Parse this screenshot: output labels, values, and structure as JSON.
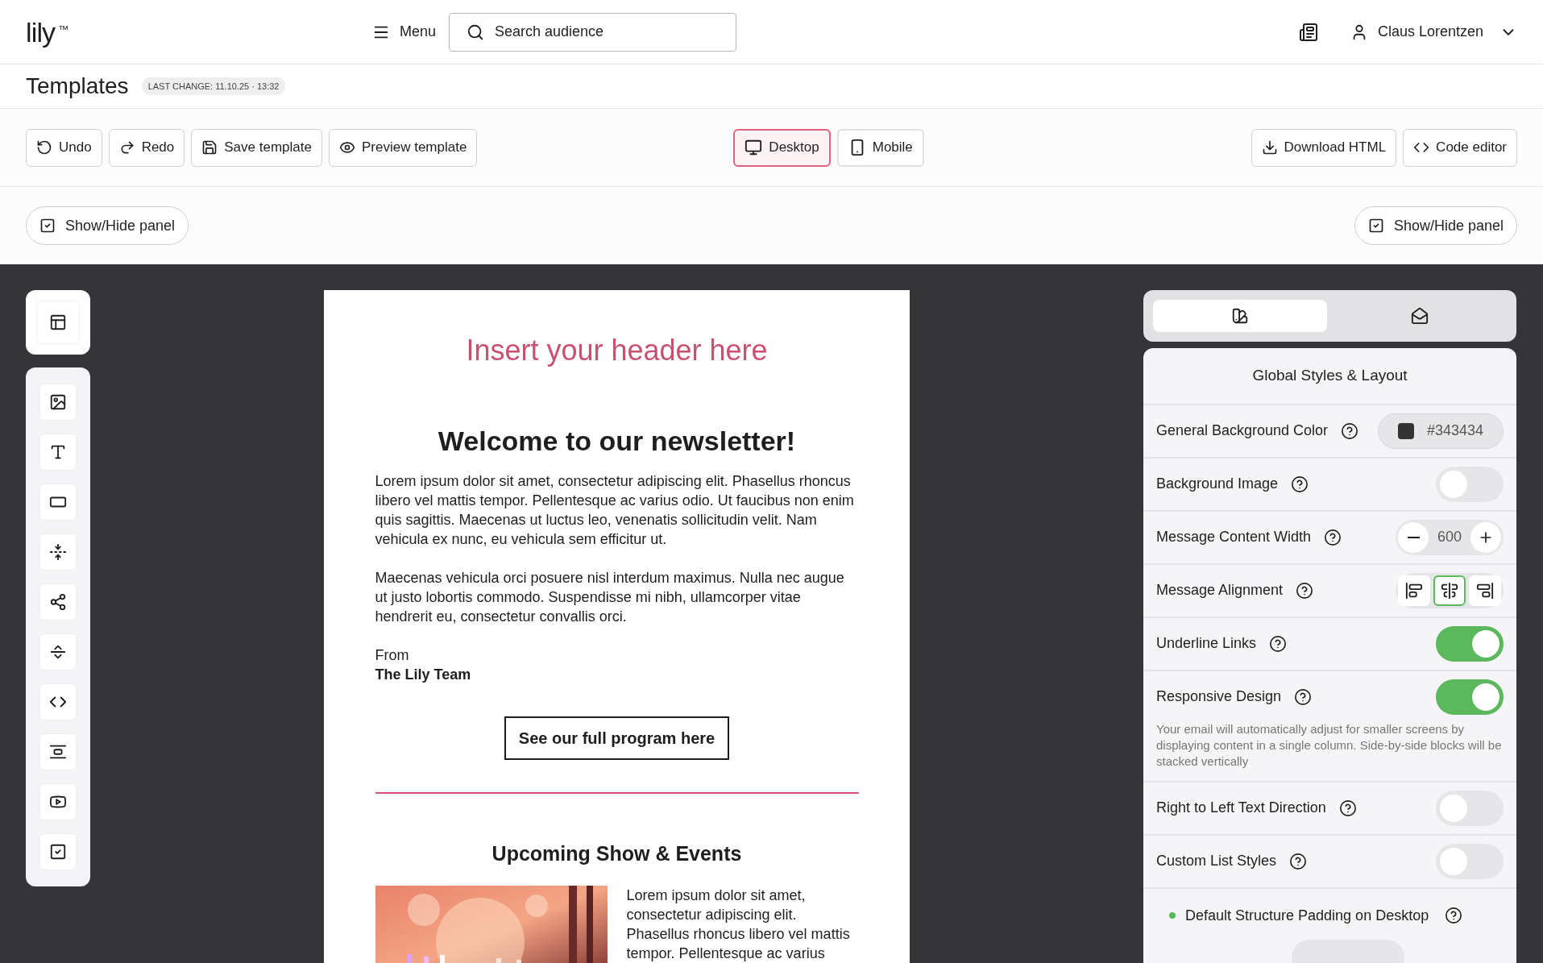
{
  "header": {
    "logo": "lily",
    "logo_mark": "™",
    "menu": "Menu",
    "search_placeholder": "Search audience",
    "user": "Claus Lorentzen"
  },
  "page": {
    "title": "Templates",
    "last_change": "LAST CHANGE: 11.10.25 · 13:32"
  },
  "toolbar": {
    "left": [
      "Undo",
      "Redo",
      "Save template",
      "Preview template"
    ],
    "views": [
      {
        "label": "Desktop",
        "selected": true
      },
      {
        "label": "Mobile",
        "selected": false
      }
    ],
    "right": [
      "Download HTML",
      "Code editor"
    ]
  },
  "panel_toggles": [
    "Show/Hide panel",
    "Show/Hide panel"
  ],
  "email": {
    "header": "Insert your header here",
    "title": "Welcome to our newsletter!",
    "paragraphs": [
      "Lorem ipsum dolor sit amet, consectetur adipiscing elit. Phasellus rhoncus libero vel mattis tempor. Pellentesque ac varius odio. Ut faucibus non enim quis sagittis. Maecenas ut luctus leo, venenatis sollicitudin velit. Nam vehicula ex nunc, eu vehicula sem efficitur ut.",
      "Maecenas vehicula orci posuere nisl interdum maximus. Nulla nec augue ut justo lobortis commodo. Suspendisse mi nibh, ullamcorper vitae hendrerit eu, consectetur convallis orci."
    ],
    "from": "From",
    "signature": "The Lily Team",
    "button": "See our full program here",
    "section_title": "Upcoming Show & Events",
    "event_text": "Lorem ipsum dolor sit amet, consectetur adipiscing elit. Phasellus rhoncus libero vel mattis tempor. Pellentesque ac varius"
  },
  "settings": {
    "tabs": [
      {
        "kind": "styles",
        "selected": true
      },
      {
        "kind": "mail",
        "selected": false
      }
    ],
    "title": "Global Styles & Layout",
    "rows": [
      {
        "kind": "color",
        "label": "General Background Color",
        "value": "#343434",
        "color": "#343434"
      },
      {
        "kind": "toggle",
        "label": "Background Image",
        "on": false
      },
      {
        "kind": "stepper",
        "label": "Message Content Width",
        "value": "600"
      },
      {
        "kind": "alignment",
        "label": "Message Alignment",
        "options": [
          {
            "kind": "left",
            "selected": false
          },
          {
            "kind": "center",
            "selected": true
          },
          {
            "kind": "right",
            "selected": false
          }
        ]
      },
      {
        "kind": "toggle",
        "label": "Underline Links",
        "on": true
      },
      {
        "kind": "toggle",
        "label": "Responsive Design",
        "on": true,
        "description": "Your email will automatically adjust for smaller screens by displaying content in a single column. Side-by-side blocks will be stacked vertically"
      },
      {
        "kind": "toggle",
        "label": "Right to Left Text Direction",
        "on": false
      },
      {
        "kind": "toggle",
        "label": "Custom List Styles",
        "on": false
      },
      {
        "kind": "heading",
        "label": "Default Structure Padding on Desktop",
        "color": "#5cb85c"
      }
    ]
  }
}
